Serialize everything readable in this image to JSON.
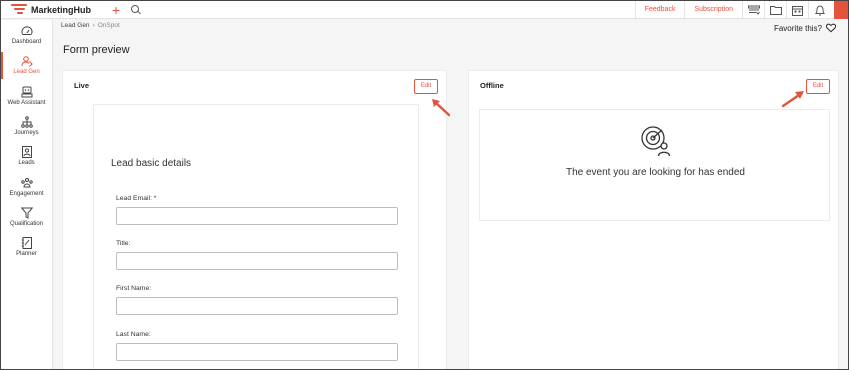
{
  "app": {
    "brand": "MarketingHub",
    "accent_color": "#e5533c"
  },
  "topbar": {
    "feedback_label": "Feedback",
    "subscription_label": "Subscription",
    "icons": [
      "add-icon",
      "search-icon",
      "inbox-icon",
      "folder-icon",
      "calendar-icon",
      "bell-icon",
      "avatar"
    ]
  },
  "sidebar": {
    "items": [
      {
        "label": "Dashboard",
        "icon": "gauge-icon",
        "active": false
      },
      {
        "label": "Lead Gen",
        "icon": "lead-gen-icon",
        "active": true
      },
      {
        "label": "Web Assistant",
        "icon": "web-assistant-icon",
        "active": false
      },
      {
        "label": "Journeys",
        "icon": "journeys-icon",
        "active": false
      },
      {
        "label": "Leads",
        "icon": "leads-icon",
        "active": false
      },
      {
        "label": "Engagement",
        "icon": "engagement-icon",
        "active": false
      },
      {
        "label": "Qualification",
        "icon": "filter-icon",
        "active": false
      },
      {
        "label": "Planner",
        "icon": "planner-icon",
        "active": false
      }
    ]
  },
  "breadcrumb": {
    "parent": "Lead Gen",
    "separator": "›",
    "current": "OnSpot"
  },
  "favorite": {
    "label": "Favorite this?"
  },
  "page": {
    "title": "Form preview"
  },
  "live": {
    "title": "Live",
    "edit_label": "Edit",
    "form": {
      "heading": "Lead basic details",
      "fields": [
        {
          "label": "Lead Email: *",
          "value": ""
        },
        {
          "label": "Title:",
          "value": ""
        },
        {
          "label": "First Name:",
          "value": ""
        },
        {
          "label": "Last Name:",
          "value": ""
        }
      ]
    }
  },
  "offline": {
    "title": "Offline",
    "edit_label": "Edit",
    "message": "The event you are looking for has ended",
    "icon": "target-user-icon"
  }
}
